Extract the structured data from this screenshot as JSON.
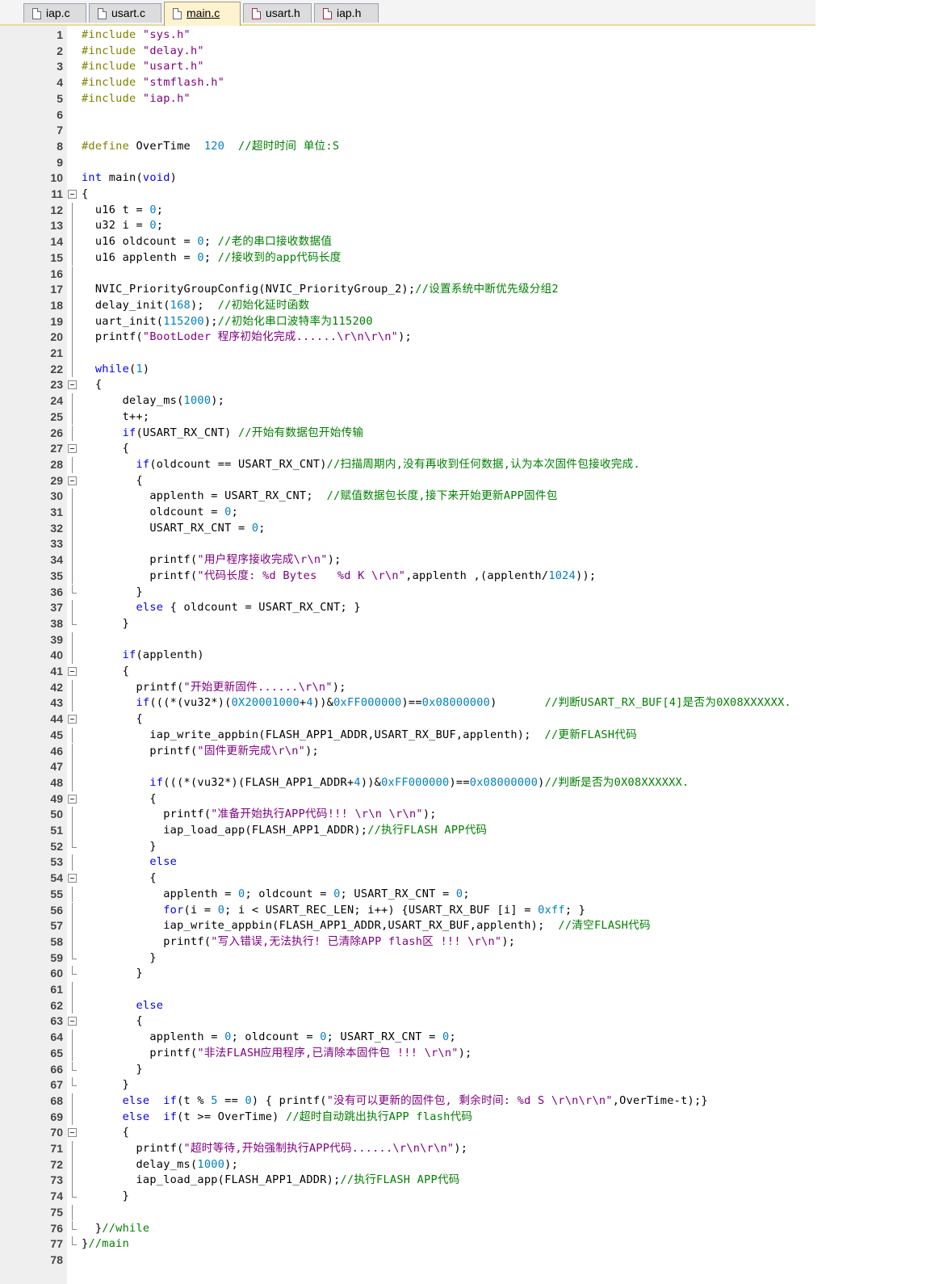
{
  "tabs": [
    {
      "label": "iap.c",
      "type": "c",
      "active": false
    },
    {
      "label": "usart.c",
      "type": "c",
      "active": false
    },
    {
      "label": "main.c",
      "type": "c",
      "active": true
    },
    {
      "label": "usart.h",
      "type": "h",
      "active": false
    },
    {
      "label": "iap.h",
      "type": "h",
      "active": false
    }
  ],
  "colors": {
    "preprocessor": "#808000",
    "string": "#800080",
    "keyword": "#0000ff",
    "number": "#0080c0",
    "comment": "#008000",
    "active_tab": "#fff3cf"
  },
  "lines": [
    {
      "n": "1",
      "fold": "",
      "text": "#include \"sys.h\""
    },
    {
      "n": "2",
      "fold": "",
      "text": "#include \"delay.h\""
    },
    {
      "n": "3",
      "fold": "",
      "text": "#include \"usart.h\""
    },
    {
      "n": "4",
      "fold": "",
      "text": "#include \"stmflash.h\""
    },
    {
      "n": "5",
      "fold": "",
      "text": "#include \"iap.h\""
    },
    {
      "n": "6",
      "fold": "",
      "text": ""
    },
    {
      "n": "7",
      "fold": "",
      "text": ""
    },
    {
      "n": "8",
      "fold": "",
      "text": "#define OverTime  120  //超时时间 单位:S"
    },
    {
      "n": "9",
      "fold": "",
      "text": ""
    },
    {
      "n": "10",
      "fold": "",
      "text": "int main(void)"
    },
    {
      "n": "11",
      "fold": "open",
      "text": "{"
    },
    {
      "n": "12",
      "fold": "mid",
      "text": "  u16 t = 0;"
    },
    {
      "n": "13",
      "fold": "mid",
      "text": "  u32 i = 0;"
    },
    {
      "n": "14",
      "fold": "mid",
      "text": "  u16 oldcount = 0; //老的串口接收数据值"
    },
    {
      "n": "15",
      "fold": "mid",
      "text": "  u16 applenth = 0; //接收到的app代码长度"
    },
    {
      "n": "16",
      "fold": "mid",
      "text": ""
    },
    {
      "n": "17",
      "fold": "mid",
      "text": "  NVIC_PriorityGroupConfig(NVIC_PriorityGroup_2);//设置系统中断优先级分组2"
    },
    {
      "n": "18",
      "fold": "mid",
      "text": "  delay_init(168);  //初始化延时函数"
    },
    {
      "n": "19",
      "fold": "mid",
      "text": "  uart_init(115200);//初始化串口波特率为115200"
    },
    {
      "n": "20",
      "fold": "mid",
      "text": "  printf(\"BootLoder 程序初始化完成......\\r\\n\\r\\n\");"
    },
    {
      "n": "21",
      "fold": "mid",
      "text": ""
    },
    {
      "n": "22",
      "fold": "mid",
      "text": "  while(1)"
    },
    {
      "n": "23",
      "fold": "open",
      "text": "  {"
    },
    {
      "n": "24",
      "fold": "mid",
      "text": "      delay_ms(1000);"
    },
    {
      "n": "25",
      "fold": "mid",
      "text": "      t++;"
    },
    {
      "n": "26",
      "fold": "mid",
      "text": "      if(USART_RX_CNT) //开始有数据包开始传输"
    },
    {
      "n": "27",
      "fold": "open",
      "text": "      {"
    },
    {
      "n": "28",
      "fold": "mid",
      "text": "        if(oldcount == USART_RX_CNT)//扫描周期内,没有再收到任何数据,认为本次固件包接收完成."
    },
    {
      "n": "29",
      "fold": "open",
      "text": "        {"
    },
    {
      "n": "30",
      "fold": "mid",
      "text": "          applenth = USART_RX_CNT;  //赋值数据包长度,接下来开始更新APP固件包"
    },
    {
      "n": "31",
      "fold": "mid",
      "text": "          oldcount = 0;"
    },
    {
      "n": "32",
      "fold": "mid",
      "text": "          USART_RX_CNT = 0;"
    },
    {
      "n": "33",
      "fold": "mid",
      "text": ""
    },
    {
      "n": "34",
      "fold": "mid",
      "text": "          printf(\"用户程序接收完成\\r\\n\");"
    },
    {
      "n": "35",
      "fold": "mid",
      "text": "          printf(\"代码长度: %d Bytes   %d K \\r\\n\",applenth ,(applenth/1024));"
    },
    {
      "n": "36",
      "fold": "end",
      "text": "        }"
    },
    {
      "n": "37",
      "fold": "mid",
      "text": "        else { oldcount = USART_RX_CNT; }"
    },
    {
      "n": "38",
      "fold": "end",
      "text": "      }"
    },
    {
      "n": "39",
      "fold": "mid",
      "text": ""
    },
    {
      "n": "40",
      "fold": "mid",
      "text": "      if(applenth)"
    },
    {
      "n": "41",
      "fold": "open",
      "text": "      {"
    },
    {
      "n": "42",
      "fold": "mid",
      "text": "        printf(\"开始更新固件......\\r\\n\");"
    },
    {
      "n": "43",
      "fold": "mid",
      "text": "        if(((*(vu32*)(0X20001000+4))&0xFF000000)==0x08000000)       //判断USART_RX_BUF[4]是否为0X08XXXXXX."
    },
    {
      "n": "44",
      "fold": "open",
      "text": "        {"
    },
    {
      "n": "45",
      "fold": "mid",
      "text": "          iap_write_appbin(FLASH_APP1_ADDR,USART_RX_BUF,applenth);  //更新FLASH代码"
    },
    {
      "n": "46",
      "fold": "mid",
      "text": "          printf(\"固件更新完成\\r\\n\");"
    },
    {
      "n": "47",
      "fold": "mid",
      "text": ""
    },
    {
      "n": "48",
      "fold": "mid",
      "text": "          if(((*(vu32*)(FLASH_APP1_ADDR+4))&0xFF000000)==0x08000000)//判断是否为0X08XXXXXX."
    },
    {
      "n": "49",
      "fold": "open",
      "text": "          {"
    },
    {
      "n": "50",
      "fold": "mid",
      "text": "            printf(\"准备开始执行APP代码!!! \\r\\n \\r\\n\");"
    },
    {
      "n": "51",
      "fold": "mid",
      "text": "            iap_load_app(FLASH_APP1_ADDR);//执行FLASH APP代码"
    },
    {
      "n": "52",
      "fold": "end",
      "text": "          }"
    },
    {
      "n": "53",
      "fold": "mid",
      "text": "          else"
    },
    {
      "n": "54",
      "fold": "open",
      "text": "          {"
    },
    {
      "n": "55",
      "fold": "mid",
      "text": "            applenth = 0; oldcount = 0; USART_RX_CNT = 0;"
    },
    {
      "n": "56",
      "fold": "mid",
      "text": "            for(i = 0; i < USART_REC_LEN; i++) {USART_RX_BUF [i] = 0xff; }"
    },
    {
      "n": "57",
      "fold": "mid",
      "text": "            iap_write_appbin(FLASH_APP1_ADDR,USART_RX_BUF,applenth);  //清空FLASH代码"
    },
    {
      "n": "58",
      "fold": "mid",
      "text": "            printf(\"写入错误,无法执行! 已清除APP flash区 !!! \\r\\n\");"
    },
    {
      "n": "59",
      "fold": "end",
      "text": "          }"
    },
    {
      "n": "60",
      "fold": "end",
      "text": "        }"
    },
    {
      "n": "61",
      "fold": "mid",
      "text": ""
    },
    {
      "n": "62",
      "fold": "mid",
      "text": "        else"
    },
    {
      "n": "63",
      "fold": "open",
      "text": "        {"
    },
    {
      "n": "64",
      "fold": "mid",
      "text": "          applenth = 0; oldcount = 0; USART_RX_CNT = 0;"
    },
    {
      "n": "65",
      "fold": "mid",
      "text": "          printf(\"非法FLASH应用程序,已清除本固件包 !!! \\r\\n\");"
    },
    {
      "n": "66",
      "fold": "end",
      "text": "        }"
    },
    {
      "n": "67",
      "fold": "end",
      "text": "      }"
    },
    {
      "n": "68",
      "fold": "mid",
      "text": "      else  if(t % 5 == 0) { printf(\"没有可以更新的固件包, 剩余时间: %d S \\r\\n\\r\\n\",OverTime-t);}"
    },
    {
      "n": "69",
      "fold": "mid",
      "text": "      else  if(t >= OverTime) //超时自动跳出执行APP flash代码"
    },
    {
      "n": "70",
      "fold": "open",
      "text": "      {"
    },
    {
      "n": "71",
      "fold": "mid",
      "text": "        printf(\"超时等待,开始强制执行APP代码......\\r\\n\\r\\n\");"
    },
    {
      "n": "72",
      "fold": "mid",
      "text": "        delay_ms(1000);"
    },
    {
      "n": "73",
      "fold": "mid",
      "text": "        iap_load_app(FLASH_APP1_ADDR);//执行FLASH APP代码"
    },
    {
      "n": "74",
      "fold": "end",
      "text": "      }"
    },
    {
      "n": "75",
      "fold": "mid",
      "text": ""
    },
    {
      "n": "76",
      "fold": "end",
      "text": "  }//while"
    },
    {
      "n": "77",
      "fold": "end",
      "text": "}//main"
    },
    {
      "n": "78",
      "fold": "",
      "text": ""
    }
  ]
}
